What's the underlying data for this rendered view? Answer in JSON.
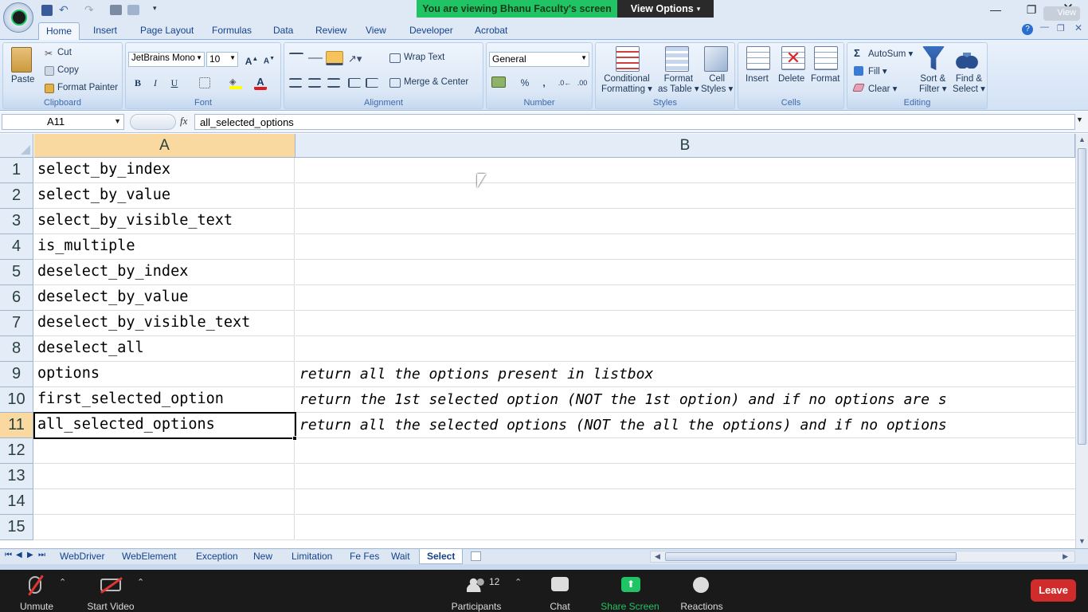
{
  "zoom_banner": {
    "viewing": "You are viewing Bhanu Faculty's screen",
    "view_options": "View Options",
    "view_label": "View"
  },
  "ribbon_tabs": [
    "Home",
    "Insert",
    "Page Layout",
    "Formulas",
    "Data",
    "Review",
    "View",
    "Developer",
    "Acrobat"
  ],
  "clipboard": {
    "paste": "Paste",
    "cut": "Cut",
    "copy": "Copy",
    "format_painter": "Format Painter",
    "label": "Clipboard"
  },
  "font": {
    "name": "JetBrains Mono",
    "size": "10",
    "bold": "B",
    "italic": "I",
    "underline": "U",
    "label": "Font"
  },
  "alignment": {
    "wrap_text": "Wrap Text",
    "merge_center": "Merge & Center",
    "label": "Alignment"
  },
  "number": {
    "format": "General",
    "percent": "%",
    "comma": ",",
    "label": "Number"
  },
  "styles": {
    "conditional_1": "Conditional",
    "conditional_2": "Formatting",
    "format_table_1": "Format",
    "format_table_2": "as Table",
    "cell_styles_1": "Cell",
    "cell_styles_2": "Styles",
    "label": "Styles"
  },
  "cells": {
    "insert": "Insert",
    "delete": "Delete",
    "format": "Format",
    "label": "Cells"
  },
  "editing": {
    "autosum": "AutoSum",
    "fill": "Fill",
    "clear": "Clear",
    "sort_1": "Sort &",
    "sort_2": "Filter",
    "find_1": "Find &",
    "find_2": "Select",
    "label": "Editing"
  },
  "formula_bar": {
    "name_box": "A11",
    "fx": "fx",
    "content": "all_selected_options"
  },
  "columns": [
    "A",
    "B"
  ],
  "rows": [
    {
      "n": "1",
      "a": "select_by_index",
      "b": ""
    },
    {
      "n": "2",
      "a": "select_by_value",
      "b": ""
    },
    {
      "n": "3",
      "a": "select_by_visible_text",
      "b": ""
    },
    {
      "n": "4",
      "a": "is_multiple",
      "b": ""
    },
    {
      "n": "5",
      "a": "deselect_by_index",
      "b": ""
    },
    {
      "n": "6",
      "a": "deselect_by_value",
      "b": ""
    },
    {
      "n": "7",
      "a": "deselect_by_visible_text",
      "b": ""
    },
    {
      "n": "8",
      "a": "deselect_all",
      "b": ""
    },
    {
      "n": "9",
      "a": "options",
      "b": "return all the options present in listbox"
    },
    {
      "n": "10",
      "a": "first_selected_option",
      "b": "return the 1st selected option (NOT the 1st option) and if no options are s"
    },
    {
      "n": "11",
      "a": "all_selected_options",
      "b": "return all the selected options (NOT the all the options) and if no options"
    },
    {
      "n": "12",
      "a": "",
      "b": ""
    },
    {
      "n": "13",
      "a": "",
      "b": ""
    },
    {
      "n": "14",
      "a": "",
      "b": ""
    },
    {
      "n": "15",
      "a": "",
      "b": ""
    }
  ],
  "sheet_tabs": [
    "WebDriver",
    "WebElement",
    "Exception",
    "New",
    "Limitation",
    "Fe Fes",
    "Wait",
    "Select"
  ],
  "active_sheet": "Select",
  "zoom_toolbar": {
    "unmute": "Unmute",
    "start_video": "Start Video",
    "participants": "Participants",
    "participants_count": "12",
    "chat": "Chat",
    "share_screen": "Share Screen",
    "reactions": "Reactions",
    "leave": "Leave"
  },
  "colors": {
    "zoom_green": "#20c464",
    "leave_red": "#d12c2c",
    "selected_col_header": "#f9d99f"
  }
}
